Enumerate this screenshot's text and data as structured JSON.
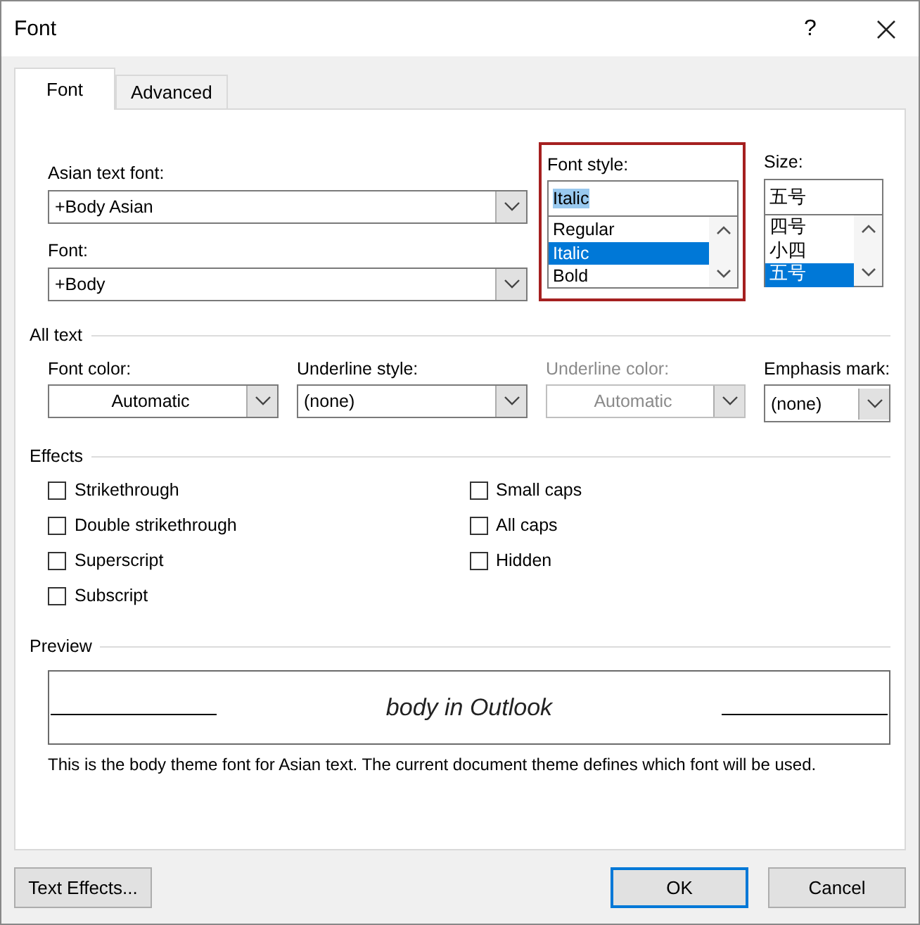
{
  "window": {
    "title": "Font",
    "help": "?"
  },
  "tabs": [
    {
      "label": "Font",
      "selected": true
    },
    {
      "label": "Advanced",
      "selected": false
    }
  ],
  "asian_text_font": {
    "label": "Asian text font:",
    "value": "+Body Asian"
  },
  "font": {
    "label": "Font:",
    "value": "+Body"
  },
  "font_style": {
    "label": "Font style:",
    "value": "Italic",
    "highlighted": true,
    "options": [
      {
        "label": "Regular",
        "selected": false
      },
      {
        "label": "Italic",
        "selected": true
      },
      {
        "label": "Bold",
        "selected": false
      }
    ]
  },
  "size": {
    "label": "Size:",
    "value": "五号",
    "options": [
      {
        "label": "四号",
        "selected": false
      },
      {
        "label": "小四",
        "selected": false
      },
      {
        "label": "五号",
        "selected": true
      }
    ]
  },
  "all_text": {
    "heading": "All text",
    "fields": [
      {
        "kind": "color",
        "label": "Font color:",
        "value": "Automatic",
        "disabled": false
      },
      {
        "kind": "list",
        "label": "Underline style:",
        "value": "(none)",
        "disabled": false
      },
      {
        "kind": "color",
        "label": "Underline color:",
        "value": "Automatic",
        "disabled": true
      },
      {
        "kind": "list",
        "label": "Emphasis mark:",
        "value": "(none)",
        "disabled": false
      }
    ]
  },
  "effects": {
    "heading": "Effects",
    "left": [
      {
        "label": "Strikethrough",
        "checked": false
      },
      {
        "label": "Double strikethrough",
        "checked": false
      },
      {
        "label": "Superscript",
        "checked": false
      },
      {
        "label": "Subscript",
        "checked": false
      }
    ],
    "right": [
      {
        "label": "Small caps",
        "checked": false
      },
      {
        "label": "All caps",
        "checked": false
      },
      {
        "label": "Hidden",
        "checked": false
      }
    ]
  },
  "preview": {
    "heading": "Preview",
    "sample": "body in Outlook",
    "description": "This is the body theme font for Asian text. The current document theme defines which font will be used."
  },
  "buttons": [
    {
      "label": "Text Effects...",
      "default": false
    },
    {
      "label": "OK",
      "default": true
    },
    {
      "label": "Cancel",
      "default": false
    }
  ]
}
